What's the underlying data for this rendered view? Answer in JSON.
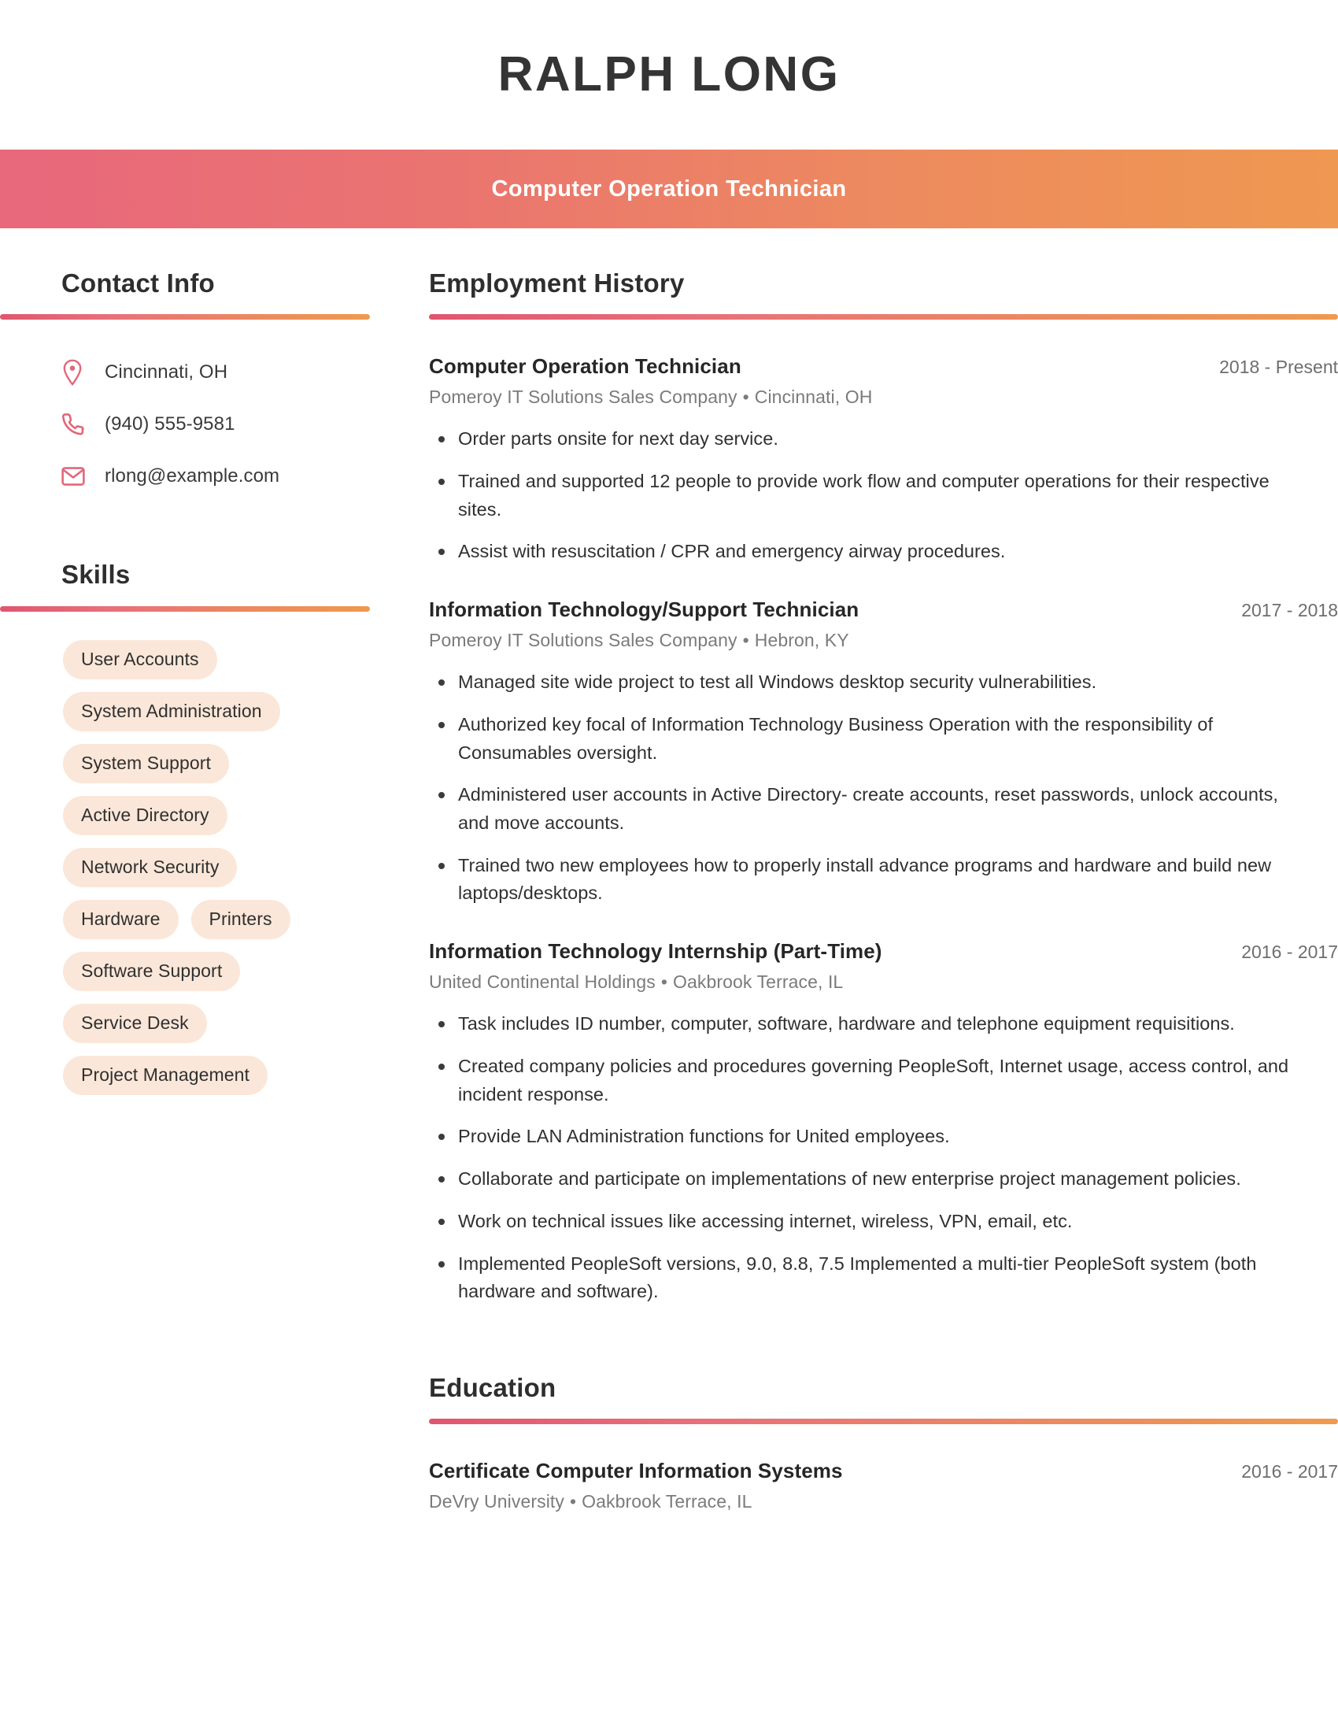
{
  "header": {
    "name": "RALPH LONG",
    "subtitle": "Computer Operation Technician",
    "banner_gradient_start": "#e8687c",
    "banner_gradient_end": "#ef9851"
  },
  "sidebar": {
    "contact": {
      "title": "Contact Info",
      "items": [
        {
          "icon": "location-pin-icon",
          "value": "Cincinnati, OH"
        },
        {
          "icon": "phone-icon",
          "value": "(940) 555-9581"
        },
        {
          "icon": "envelope-icon",
          "value": "rlong@example.com"
        }
      ]
    },
    "skills": {
      "title": "Skills",
      "items": [
        "User Accounts",
        "System Administration",
        "System Support",
        "Active Directory",
        "Network Security",
        "Hardware",
        "Printers",
        "Software Support",
        "Service Desk",
        "Project Management"
      ]
    },
    "accent_color": "#e2677a",
    "pill_background": "#fbe7d9"
  },
  "main": {
    "employment": {
      "title": "Employment History",
      "jobs": [
        {
          "title": "Computer Operation Technician",
          "dates": "2018 - Present",
          "company": "Pomeroy IT Solutions Sales Company",
          "separator": "•",
          "location": "Cincinnati, OH",
          "bullets": [
            "Order parts onsite for next day service.",
            "Trained and supported 12 people to provide work flow and computer operations for their respective sites.",
            "Assist with resuscitation / CPR and emergency airway procedures."
          ]
        },
        {
          "title": "Information Technology/Support Technician",
          "dates": "2017 - 2018",
          "company": "Pomeroy IT Solutions Sales Company",
          "separator": "•",
          "location": "Hebron, KY",
          "bullets": [
            "Managed site wide project to test all Windows desktop security vulnerabilities.",
            "Authorized key focal of Information Technology Business Operation with the responsibility of Consumables oversight.",
            "Administered user accounts in Active Directory- create accounts, reset passwords, unlock accounts, and move accounts.",
            "Trained two new employees how to properly install advance programs and hardware and build new laptops/desktops."
          ]
        },
        {
          "title": "Information Technology Internship (Part-Time)",
          "dates": "2016 - 2017",
          "company": "United Continental Holdings",
          "separator": "•",
          "location": "Oakbrook Terrace, IL",
          "bullets": [
            "Task includes ID number, computer, software, hardware and telephone equipment requisitions.",
            "Created company policies and procedures governing PeopleSoft, Internet usage, access control, and incident response.",
            "Provide LAN Administration functions for United employees.",
            "Collaborate and participate on implementations of new enterprise project management policies.",
            "Work on technical issues like accessing internet, wireless, VPN, email, etc.",
            "Implemented PeopleSoft versions, 9.0, 8.8, 7.5 Implemented a multi-tier PeopleSoft system (both hardware and software)."
          ]
        }
      ]
    },
    "education": {
      "title": "Education",
      "entries": [
        {
          "title": "Certificate Computer Information Systems",
          "dates": "2016 - 2017",
          "school": "DeVry University",
          "separator": "•",
          "location": "Oakbrook Terrace, IL"
        }
      ]
    }
  }
}
